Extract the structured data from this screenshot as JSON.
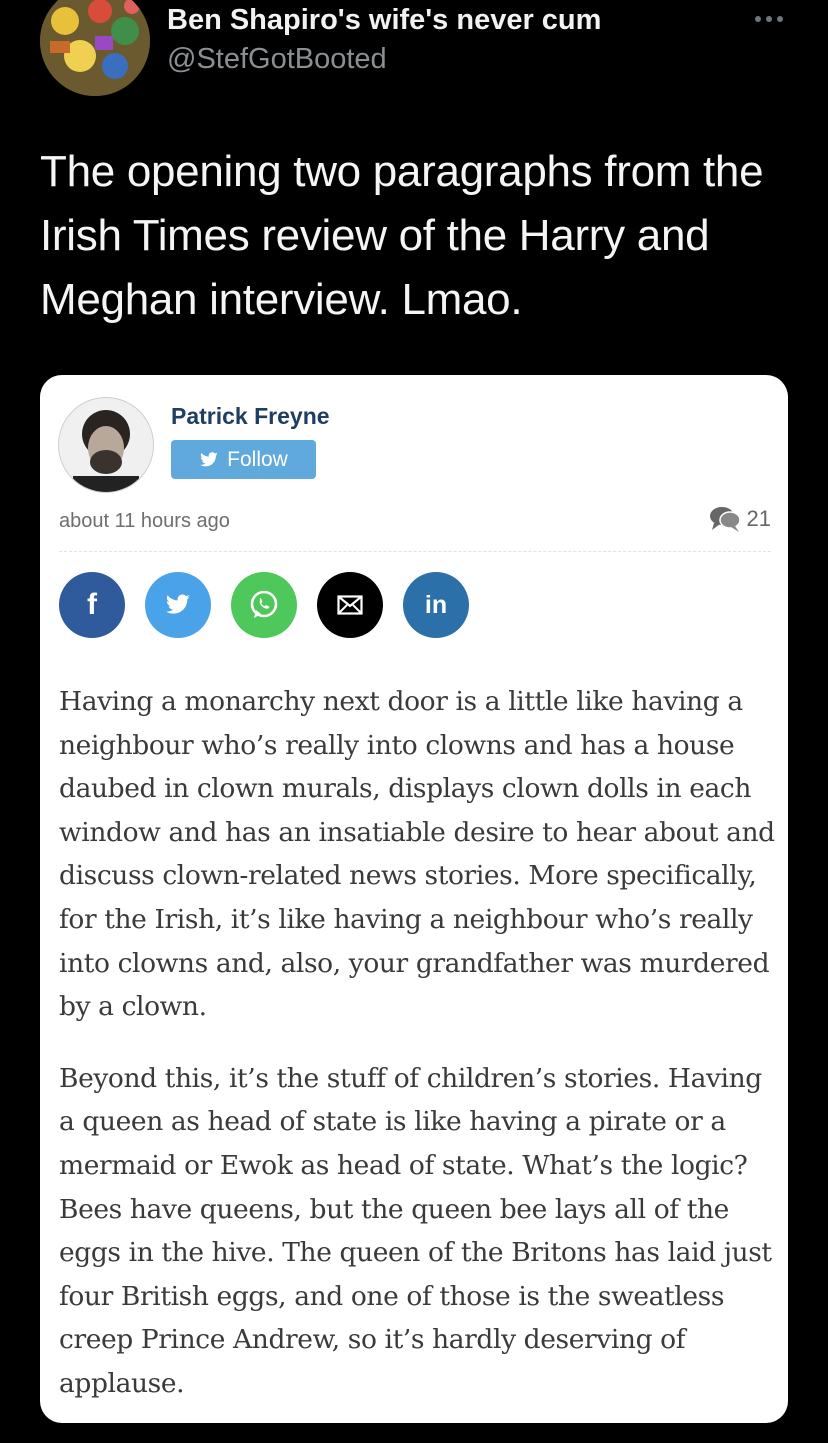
{
  "tweet": {
    "display_name": "Ben Shapiro's wife's never cum",
    "handle": "@StefGotBooted",
    "text": "The opening two paragraphs from the Irish Times review of the Harry and Meghan interview. Lmao."
  },
  "embed": {
    "author_name": "Patrick Freyne",
    "follow_label": "Follow",
    "timestamp": "about 11 hours ago",
    "comment_count": "21",
    "share_buttons": [
      {
        "name": "facebook",
        "glyph": "f"
      },
      {
        "name": "twitter",
        "glyph": ""
      },
      {
        "name": "whatsapp",
        "glyph": ""
      },
      {
        "name": "email",
        "glyph": ""
      },
      {
        "name": "linkedin",
        "glyph": "in"
      }
    ],
    "paragraphs": [
      "Having a monarchy next door is a little like having a neighbour who’s really into clowns and has a house daubed in clown murals, displays clown dolls in each window and has an insatiable desire to hear about and discuss clown-related news stories. More specifically, for the Irish, it’s like having a neighbour who’s really into clowns and, also, your grandfather was murdered by a clown.",
      "Beyond this, it’s the stuff of children’s stories. Having a queen as head of state is like having a pirate or a mermaid or Ewok as head of state. What’s the logic? Bees have queens, but the queen bee lays all of the eggs in the hive. The queen of the Britons has laid just four British eggs, and one of those is the sweatless creep Prince Andrew, so it’s hardly deserving of applause."
    ]
  },
  "colors": {
    "background": "#000000",
    "card": "#ffffff",
    "author_link": "#1f3e64",
    "follow_button": "#5fa9dd",
    "facebook": "#2f5a9c",
    "twitter": "#4aa3e8",
    "whatsapp": "#4ec85a",
    "email": "#000000",
    "linkedin": "#2b70a8"
  }
}
